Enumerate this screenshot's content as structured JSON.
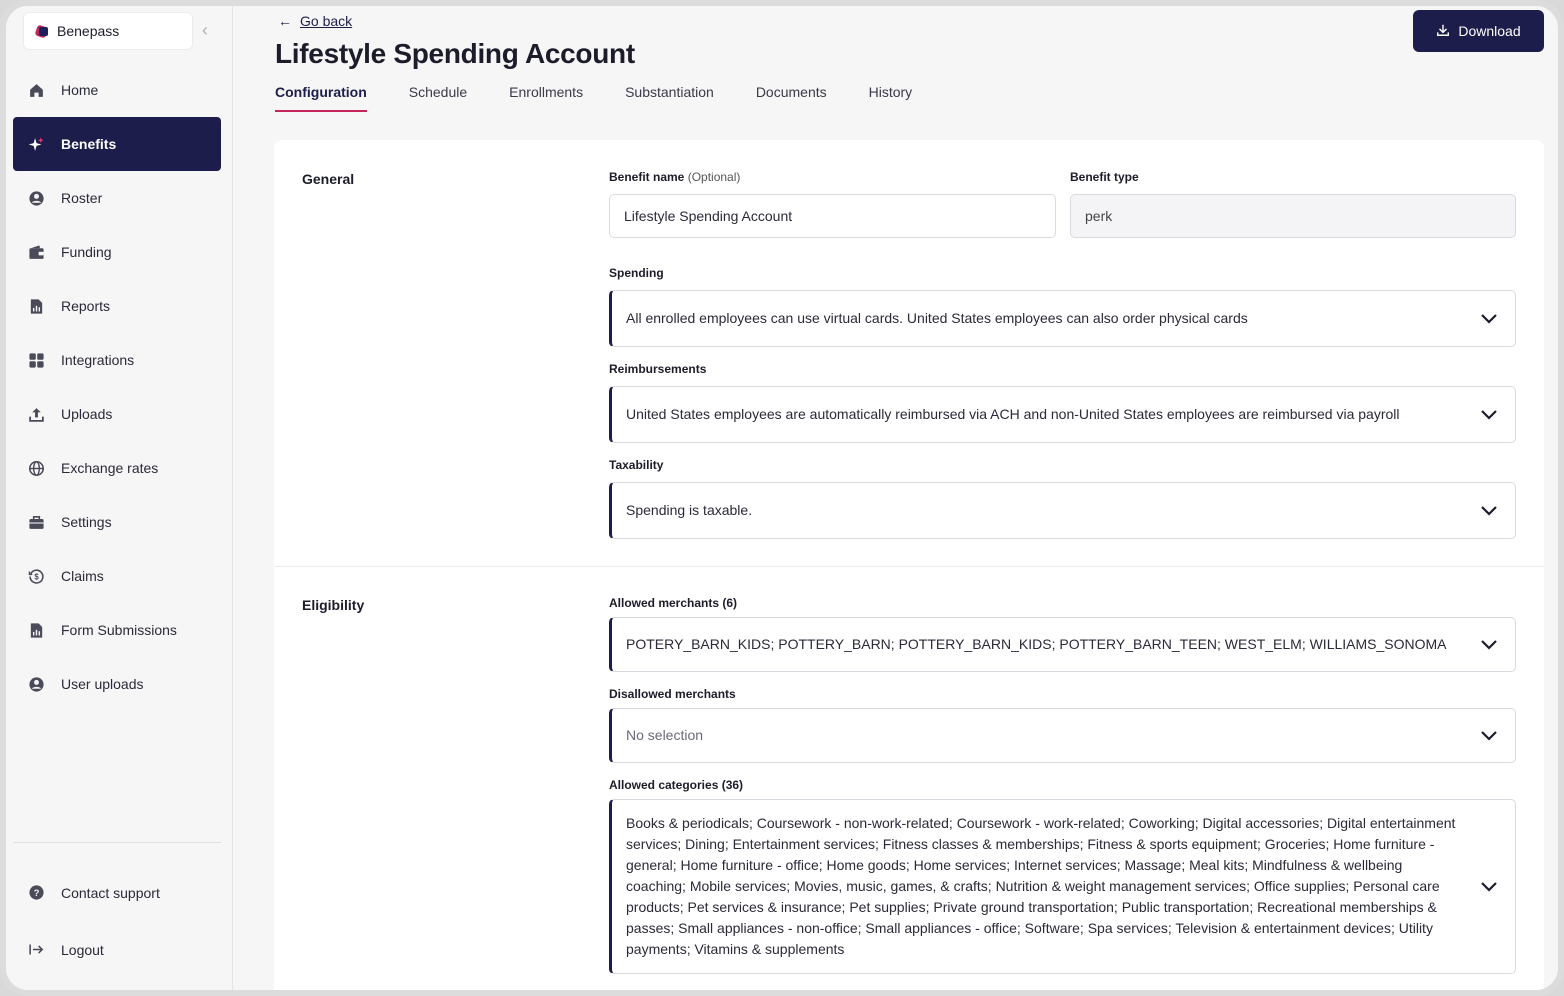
{
  "sidebar": {
    "brand": "Benepass",
    "items": [
      {
        "label": "Home",
        "icon": "home-icon"
      },
      {
        "label": "Benefits",
        "icon": "sparkle-icon",
        "active": true
      },
      {
        "label": "Roster",
        "icon": "user-circle-icon"
      },
      {
        "label": "Funding",
        "icon": "wallet-icon"
      },
      {
        "label": "Reports",
        "icon": "report-icon"
      },
      {
        "label": "Integrations",
        "icon": "grid-icon"
      },
      {
        "label": "Uploads",
        "icon": "upload-icon"
      },
      {
        "label": "Exchange rates",
        "icon": "globe-icon"
      },
      {
        "label": "Settings",
        "icon": "briefcase-icon"
      },
      {
        "label": "Claims",
        "icon": "dollar-circle-icon"
      },
      {
        "label": "Form Submissions",
        "icon": "report-icon"
      },
      {
        "label": "User uploads",
        "icon": "user-circle-icon"
      }
    ],
    "bottom": [
      {
        "label": "Contact support",
        "icon": "help-icon"
      },
      {
        "label": "Logout",
        "icon": "logout-icon"
      }
    ]
  },
  "header": {
    "go_back": "Go back",
    "title": "Lifestyle Spending Account",
    "download": "Download",
    "tabs": [
      "Configuration",
      "Schedule",
      "Enrollments",
      "Substantiation",
      "Documents",
      "History"
    ]
  },
  "general": {
    "section": "General",
    "benefit_name_label": "Benefit name",
    "benefit_name_optional": "(Optional)",
    "benefit_name_value": "Lifestyle Spending Account",
    "benefit_type_label": "Benefit type",
    "benefit_type_value": "perk",
    "spending_label": "Spending",
    "spending_value": "All enrolled employees can use virtual cards. United States employees can also order physical cards",
    "reimbursements_label": "Reimbursements",
    "reimbursements_value": "United States employees are automatically reimbursed via ACH and non-United States employees are reimbursed via payroll",
    "taxability_label": "Taxability",
    "taxability_value": "Spending is taxable."
  },
  "eligibility": {
    "section": "Eligibility",
    "allowed_merchants_label": "Allowed merchants (6)",
    "allowed_merchants_value": "POTERY_BARN_KIDS; POTTERY_BARN; POTTERY_BARN_KIDS; POTTERY_BARN_TEEN; WEST_ELM; WILLIAMS_SONOMA",
    "disallowed_merchants_label": "Disallowed merchants",
    "disallowed_merchants_value": "No selection",
    "allowed_categories_label": "Allowed categories (36)",
    "allowed_categories_value": "Books & periodicals; Coursework - non-work-related; Coursework - work-related; Coworking; Digital accessories; Digital entertainment services; Dining; Entertainment services; Fitness classes & memberships; Fitness & sports equipment; Groceries; Home furniture - general; Home furniture - office; Home goods; Home services; Internet services; Massage; Meal kits; Mindfulness & wellbeing coaching; Mobile services; Movies, music, games, & crafts; Nutrition & weight management services; Office supplies; Personal care products; Pet services & insurance; Pet supplies; Private ground transportation; Public transportation; Recreational memberships & passes; Small appliances - non-office; Small appliances - office; Software; Spa services; Television & entertainment devices; Utility payments; Vitamins & supplements"
  },
  "colors": {
    "primary": "#1d1d4b",
    "accent": "#c4265b"
  }
}
